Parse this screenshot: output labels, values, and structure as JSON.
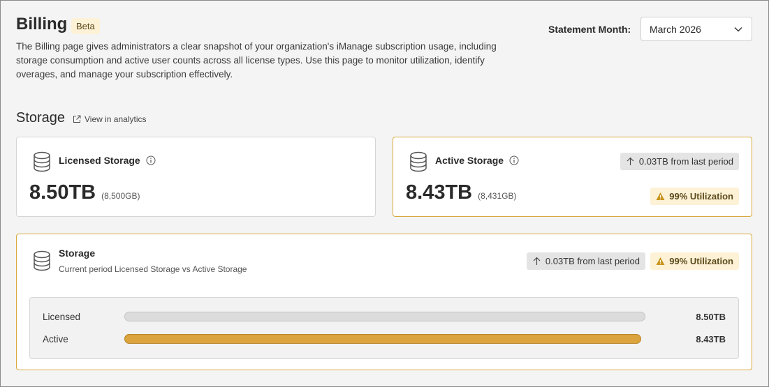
{
  "header": {
    "title": "Billing",
    "badge": "Beta",
    "description": "The Billing page gives administrators a clear snapshot of your organization's iManage subscription usage, including storage consumption and active user counts across all license types. Use this page to monitor utilization, identify overages, and manage your subscription effectively.",
    "statement_month_label": "Statement Month:",
    "statement_month_value": "March 2026"
  },
  "storage_section": {
    "title": "Storage",
    "analytics_link": "View in analytics"
  },
  "licensed_card": {
    "title": "Licensed Storage",
    "value": "8.50TB",
    "sub_value": "(8,500GB)"
  },
  "active_card": {
    "title": "Active Storage",
    "value": "8.43TB",
    "sub_value": "(8,431GB)",
    "change": "0.03TB from last period",
    "utilization": "99% Utilization"
  },
  "comparison_card": {
    "title": "Storage",
    "subtitle": "Current period Licensed Storage vs Active Storage",
    "change": "0.03TB from last period",
    "utilization": "99% Utilization",
    "bars": [
      {
        "label": "Licensed",
        "value": "8.50TB",
        "fraction": 1.0,
        "color": "#dcdcdc"
      },
      {
        "label": "Active",
        "value": "8.43TB",
        "fraction": 0.992,
        "color": "#dca43e"
      }
    ]
  },
  "colors": {
    "accent_amber": "#dca43e",
    "warning_bg": "#fdf1d6",
    "warning_icon": "#c8941c"
  },
  "icons": [
    "chevron-down-icon",
    "external-link-icon",
    "database-icon",
    "info-icon",
    "arrow-up-icon",
    "warning-icon"
  ]
}
